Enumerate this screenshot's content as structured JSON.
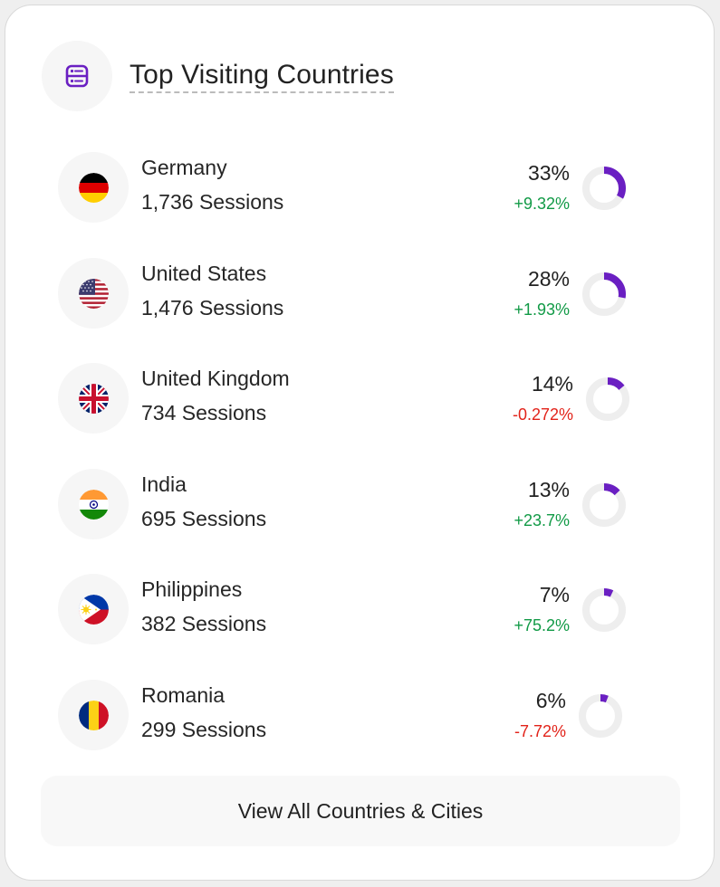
{
  "header": {
    "icon": "list-icon",
    "title": "Top Visiting Countries"
  },
  "countries": [
    {
      "name": "Germany",
      "sessions": "1,736 Sessions",
      "share": "33%",
      "share_value": 33,
      "change": "+9.32%",
      "trend": "positive",
      "flag": "germany-flag-icon"
    },
    {
      "name": "United States",
      "sessions": "1,476 Sessions",
      "share": "28%",
      "share_value": 28,
      "change": "+1.93%",
      "trend": "positive",
      "flag": "united-states-flag-icon"
    },
    {
      "name": "United Kingdom",
      "sessions": "734 Sessions",
      "share": "14%",
      "share_value": 14,
      "change": "-0.272%",
      "trend": "negative",
      "flag": "united-kingdom-flag-icon"
    },
    {
      "name": "India",
      "sessions": "695 Sessions",
      "share": "13%",
      "share_value": 13,
      "change": "+23.7%",
      "trend": "positive",
      "flag": "india-flag-icon"
    },
    {
      "name": "Philippines",
      "sessions": "382 Sessions",
      "share": "7%",
      "share_value": 7,
      "change": "+75.2%",
      "trend": "positive",
      "flag": "philippines-flag-icon"
    },
    {
      "name": "Romania",
      "sessions": "299 Sessions",
      "share": "6%",
      "share_value": 6,
      "change": "-7.72%",
      "trend": "negative",
      "flag": "romania-flag-icon"
    }
  ],
  "footer": {
    "view_all_label": "View All Countries & Cities"
  },
  "colors": {
    "accent": "#6a1fc2",
    "donut_track": "#eeeeee",
    "positive": "#119a46",
    "negative": "#e2231a"
  }
}
